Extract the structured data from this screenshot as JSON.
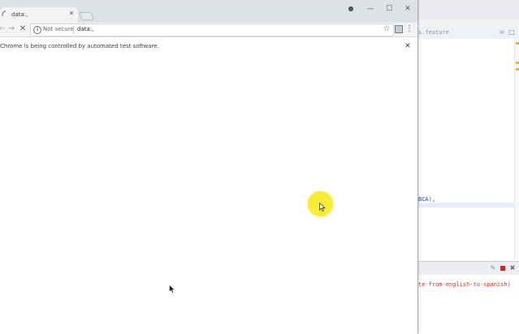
{
  "browser": {
    "tab": {
      "title": "data:,",
      "close": "✕"
    },
    "window_controls": {
      "account": "●",
      "minimize": "—",
      "maximize": "☐",
      "close": "✕"
    },
    "toolbar": {
      "back": "←",
      "forward": "→",
      "stop": "✕",
      "security_label": "Not secure",
      "url": "data:,",
      "bookmark": "☆",
      "menu": "⋮"
    },
    "infobar": {
      "message": "Chrome is being controlled by automated test software.",
      "close": "✕"
    }
  },
  "ide": {
    "editor_tab": "s.feature",
    "tab_controls": {
      "minimize": "=",
      "maximize": "□"
    },
    "code_fragment": "BCA),",
    "console_output": "te-from-english-to-spanish)",
    "console_controls": {
      "pin": "✎",
      "terminate": "■",
      "remove": "✖"
    }
  },
  "colors": {
    "chrome_frame": "#dee1e6",
    "cursor_highlight": "#f9ec36",
    "console_text": "#c4361f",
    "code_keyword": "#2a3f9a"
  }
}
